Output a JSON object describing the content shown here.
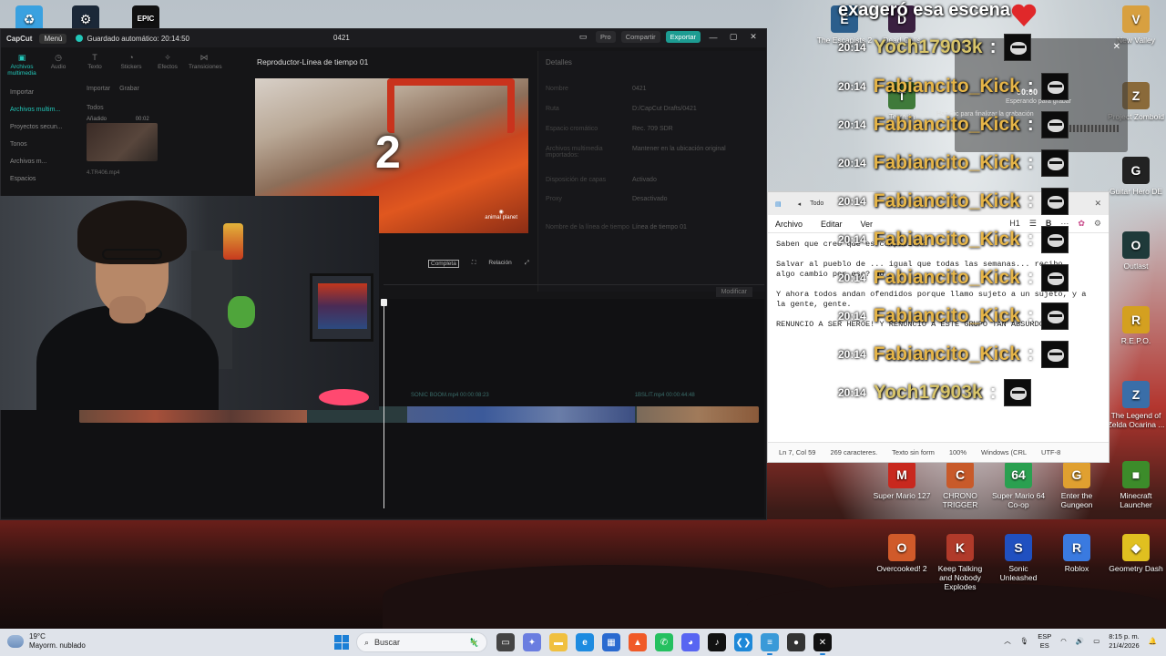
{
  "capcut": {
    "logo": "CapCut",
    "menu": "Menú",
    "autosave": "Guardado automático: 20:14:50",
    "project_name": "0421",
    "pro": "Pro",
    "share": "Compartir",
    "export": "Exportar",
    "tools": [
      "Archivos multimedia",
      "Audio",
      "Texto",
      "Stickers",
      "Efectos",
      "Transiciones"
    ],
    "sidebar": [
      "Importar",
      "Archivos multim...",
      "Proyectos secun...",
      "Tonos",
      "Archivos m...",
      "Espacios"
    ],
    "media_head": [
      "Importar",
      "Grabar"
    ],
    "todos": "Todos",
    "thumb_label": "Añadido",
    "thumb_time": "00:02",
    "thumb_name": "4.TR406.mp4",
    "player_title": "Reproductor-Línea de tiempo 01",
    "countdown": "2",
    "watermark_brand": "animal planet",
    "player_full": "Completa",
    "player_ratio": "Relación",
    "details": {
      "title": "Detalles",
      "rows": [
        {
          "k": "Nombre",
          "v": "0421"
        },
        {
          "k": "Ruta",
          "v": "D:/CapCut Drafts/0421"
        },
        {
          "k": "Espacio cromático",
          "v": "Rec. 709 SDR"
        },
        {
          "k": "Archivos multimedia importados:",
          "v": "Mantener en la ubicación original"
        },
        {
          "k": "Disposición de capas",
          "v": "Activado"
        },
        {
          "k": "Proxy",
          "v": "Desactivado"
        },
        {
          "k": "Nombre de la línea de tiempo",
          "v": "Línea de tiempo 01"
        }
      ],
      "modify": "Modificar"
    },
    "track_label_a": "SONIC BOOM.mp4  00:00:08:23",
    "track_label_b": "1BSLIT.mp4  00:00:44:48"
  },
  "desktop_icons": [
    {
      "label": "",
      "color": "#3aa1e0",
      "glyph": "♻"
    },
    {
      "label": "",
      "color": "#1b2838",
      "glyph": "⚙"
    },
    {
      "label": "",
      "color": "#111111",
      "glyph": "EPIC"
    },
    {
      "label": "The Escapists 2",
      "color": "#2b5e8c",
      "glyph": "E"
    },
    {
      "label": "Dead Cells",
      "color": "#3a2040",
      "glyph": "D"
    },
    {
      "label": "New Valley",
      "color": "#d8a040",
      "glyph": "V"
    },
    {
      "label": "Terraria",
      "color": "#3f7a3a",
      "glyph": "T"
    },
    {
      "label": "Project Zomboid",
      "color": "#8a6a3a",
      "glyph": "Z"
    },
    {
      "label": "Guitar Hero DE",
      "color": "#222222",
      "glyph": "G"
    },
    {
      "label": "Outlast",
      "color": "#1f3a3a",
      "glyph": "O"
    },
    {
      "label": "R.E.P.O.",
      "color": "#d4a020",
      "glyph": "R"
    },
    {
      "label": "The Legend of Zelda Ocarina ...",
      "color": "#3a6ea8",
      "glyph": "Z"
    },
    {
      "label": "Super Mario 127",
      "color": "#c8281e",
      "glyph": "M"
    },
    {
      "label": "CHRONO TRIGGER",
      "color": "#c85a2a",
      "glyph": "C"
    },
    {
      "label": "Super Mario 64 Co-op",
      "color": "#2aa050",
      "glyph": "64"
    },
    {
      "label": "Enter the Gungeon",
      "color": "#e0a030",
      "glyph": "G"
    },
    {
      "label": "Minecraft Launcher",
      "color": "#3c8c2a",
      "glyph": "■"
    },
    {
      "label": "Overcooked! 2",
      "color": "#d05a2a",
      "glyph": "O"
    },
    {
      "label": "Keep Talking and Nobody Explodes",
      "color": "#b03a2a",
      "glyph": "K"
    },
    {
      "label": "Sonic Unleashed",
      "color": "#2050c0",
      "glyph": "S"
    },
    {
      "label": "Roblox",
      "color": "#3a7ae0",
      "glyph": "R"
    },
    {
      "label": "Geometry Dash",
      "color": "#e0c020",
      "glyph": "◆"
    }
  ],
  "recording": {
    "status_top": "Esperando para grabar",
    "hint": "Haz clic para finalizar la grabación",
    "label": "00:00"
  },
  "notepad": {
    "tab": "Todo",
    "menu": [
      "Archivo",
      "Editar",
      "Ver"
    ],
    "heading_tool": "H1",
    "bold": "B",
    "more": "···",
    "text": "Saben que creo que es compasión?\n\nSalvar al pueblo de ... igual que todas las semanas... recibo\nalgo cambio por eso? No.\n\nY ahora todos andan ofendidos porque llamo sujeto a un sujeto, y a\nla gente, gente.\n\nRENUNCIO A SER HEROE! Y RENUNCIO A ESTE GRUPO TAN ABSURDO!",
    "status": [
      "Ln 7, Col 59",
      "269 caracteres.",
      "Texto sin form",
      "100%",
      "Windows (CRL",
      "UTF-8"
    ]
  },
  "chat": {
    "headline": "exageró esa escena",
    "messages": [
      {
        "time": "20:14",
        "user": "Yoch17903k"
      },
      {
        "time": "20:14",
        "user": "Fabiancito_Kick"
      },
      {
        "time": "20:14",
        "user": "Fabiancito_Kick"
      },
      {
        "time": "20:14",
        "user": "Fabiancito_Kick"
      },
      {
        "time": "20:14",
        "user": "Fabiancito_Kick"
      },
      {
        "time": "20:14",
        "user": "Fabiancito_Kick"
      },
      {
        "time": "20:14",
        "user": "Fabiancito_Kick"
      },
      {
        "time": "20:14",
        "user": "Fabiancito_Kick"
      },
      {
        "time": "20:14",
        "user": "Fabiancito_Kick"
      },
      {
        "time": "20:14",
        "user": "Yoch17903k"
      }
    ]
  },
  "taskbar": {
    "temp": "19°C",
    "weather": "Mayorm. nublado",
    "search_placeholder": "Buscar",
    "lang_top": "ESP",
    "lang_bottom": "ES",
    "time": "8:15 p. m.",
    "date": "21/4/2026",
    "apps": [
      {
        "name": "task-view-icon",
        "color": "#444",
        "glyph": "▭"
      },
      {
        "name": "copilot-icon",
        "color": "#6a7de0",
        "glyph": "✦"
      },
      {
        "name": "file-explorer-icon",
        "color": "#f0c040",
        "glyph": "▬"
      },
      {
        "name": "edge-icon",
        "color": "#1e8be0",
        "glyph": "e"
      },
      {
        "name": "store-icon",
        "color": "#2a6ad0",
        "glyph": "▦"
      },
      {
        "name": "brave-icon",
        "color": "#f05a28",
        "glyph": "▲"
      },
      {
        "name": "whatsapp-icon",
        "color": "#25c060",
        "glyph": "✆"
      },
      {
        "name": "discord-icon",
        "color": "#5865f2",
        "glyph": "◕"
      },
      {
        "name": "tiktok-icon",
        "color": "#111",
        "glyph": "♪"
      },
      {
        "name": "vscode-icon",
        "color": "#1e88d8",
        "glyph": "❮❯"
      },
      {
        "name": "notepad-icon",
        "color": "#3a9ad8",
        "glyph": "≡"
      },
      {
        "name": "obs-icon",
        "color": "#333",
        "glyph": "●"
      },
      {
        "name": "capcut-icon",
        "color": "#111",
        "glyph": "✕"
      }
    ]
  }
}
